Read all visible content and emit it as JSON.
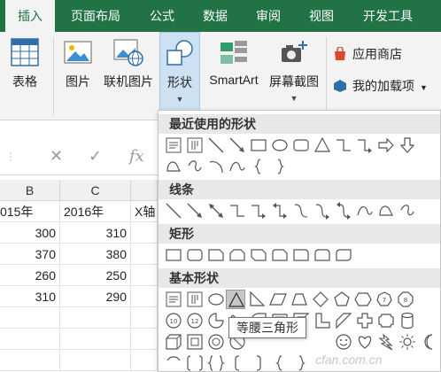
{
  "ribbon_tabs": [
    "插入",
    "页面布局",
    "公式",
    "数据",
    "审阅",
    "视图",
    "开发工具"
  ],
  "ribbon": {
    "table": "表格",
    "picture": "图片",
    "online_picture": "联机图片",
    "shapes": "形状",
    "smartart": "SmartArt",
    "screenshot": "屏幕截图",
    "store": "应用商店",
    "my_addins": "我的加载项"
  },
  "formula_bar": {
    "cancel": "✕",
    "enter": "✓",
    "fx": "fx"
  },
  "sheet": {
    "columns": [
      "B",
      "C"
    ],
    "header_row": [
      "015年",
      "2016年",
      "X轴"
    ],
    "rows": [
      [
        "300",
        "310"
      ],
      [
        "370",
        "380"
      ],
      [
        "260",
        "250"
      ],
      [
        "310",
        "290"
      ]
    ]
  },
  "gallery": {
    "sections": [
      "最近使用的形状",
      "线条",
      "矩形",
      "基本形状"
    ],
    "tooltip": "等腰三角形",
    "watermark": "cfan.com.cn"
  },
  "colors": {
    "accent": "#217346",
    "selected_button": "#cde1f3"
  }
}
